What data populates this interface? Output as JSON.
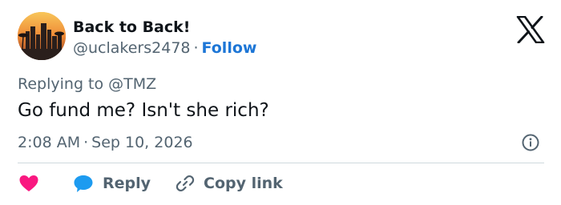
{
  "author": {
    "display_name": "Back to Back!",
    "handle": "@uclakers2478",
    "separator": "·",
    "follow_label": "Follow"
  },
  "reply_context": "Replying to @TMZ",
  "tweet": {
    "text": "Go fund me? Isn't she rich?",
    "time": "2:08 AM",
    "separator": "·",
    "date": "Sep 10, 2026"
  },
  "actions": {
    "reply_label": "Reply",
    "copy_link_label": "Copy link"
  },
  "icons": {
    "brand": "x-logo-icon",
    "info": "info-icon",
    "like": "heart-icon",
    "reply": "speech-bubble-icon",
    "copy": "link-icon"
  },
  "colors": {
    "follow": "#1d76d6",
    "heart": "#f91880",
    "reply_bubble": "#1d9bf0",
    "muted_text": "#536471"
  }
}
